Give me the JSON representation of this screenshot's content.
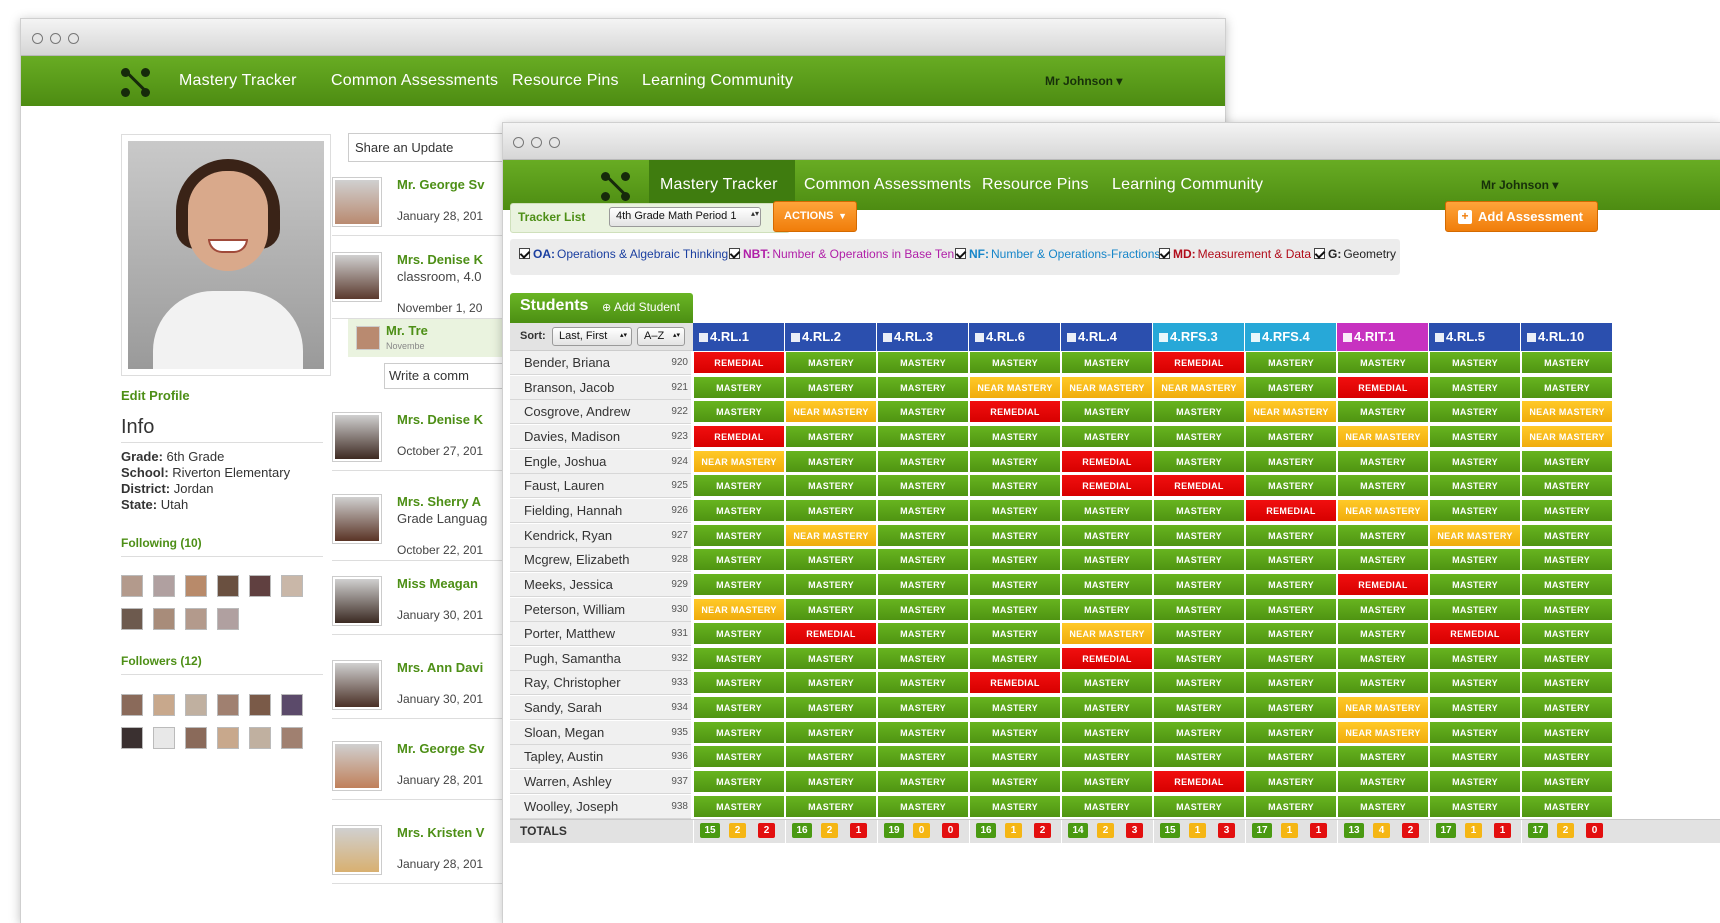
{
  "nav": {
    "items": [
      "Mastery Tracker",
      "Common Assessments",
      "Resource Pins",
      "Learning Community"
    ],
    "user": "Mr Johnson ▾"
  },
  "profile": {
    "edit": "Edit Profile",
    "info_title": "Info",
    "grade_label": "Grade:",
    "grade": "6th Grade",
    "school_label": "School:",
    "school": "Riverton Elementary",
    "district_label": "District:",
    "district": "Jordan",
    "state_label": "State:",
    "state": "Utah",
    "following": "Following (10)",
    "followers": "Followers (12)"
  },
  "feed": {
    "share_placeholder": "Share an Update",
    "write_placeholder": "Write a comm",
    "items": [
      {
        "name": "Mr. George Sv",
        "date": "January 28, 201"
      },
      {
        "name": "Mrs. Denise K",
        "line": "classroom, 4.0",
        "date": "November 1, 20"
      },
      {
        "name": "Mr. Tre",
        "date": "Novembe"
      },
      {
        "name": "Mrs. Denise K",
        "date": "October 27, 201"
      },
      {
        "name": "Mrs. Sherry A",
        "line": "Grade Languag",
        "date": "October 22, 201"
      },
      {
        "name": "Miss Meagan",
        "date": "January 30, 201"
      },
      {
        "name": "Mrs. Ann Davi",
        "date": "January 30, 201"
      },
      {
        "name": "Mr. George Sv",
        "date": "January 28, 201"
      },
      {
        "name": "Mrs. Kristen V",
        "date": "January 28, 201"
      }
    ]
  },
  "tracker": {
    "tracker_list": "Tracker List",
    "class_select": "4th Grade Math Period 1",
    "actions": "ACTIONS",
    "add_assessment": "Add Assessment",
    "categories": [
      {
        "code": "OA:",
        "label": "Operations & Algebraic Thinking",
        "color": "#1b3fa0"
      },
      {
        "code": "NBT:",
        "label": "Number & Operations in Base Ten",
        "color": "#b01fa8"
      },
      {
        "code": "NF:",
        "label": "Number & Operations-Fractions",
        "color": "#1786c9"
      },
      {
        "code": "MD:",
        "label": "Measurement & Data",
        "color": "#b10c1a"
      },
      {
        "code": "G:",
        "label": "Geometry",
        "color": "#222222"
      }
    ],
    "students_title": "Students",
    "add_student": "Add Student",
    "sort_label": "Sort:",
    "sort_field": "Last, First",
    "sort_order": "A–Z",
    "totals_label": "TOTALS",
    "legend": {
      "M": "MASTERY",
      "N": "NEAR MASTERY",
      "R": "REMEDIAL"
    },
    "columns": [
      {
        "name": "4.RL.1",
        "color": "#2b4fae"
      },
      {
        "name": "4.RL.2",
        "color": "#2b4fae"
      },
      {
        "name": "4.RL.3",
        "color": "#2b4fae"
      },
      {
        "name": "4.RL.6",
        "color": "#2b4fae"
      },
      {
        "name": "4.RL.4",
        "color": "#2b4fae"
      },
      {
        "name": "4.RFS.3",
        "color": "#27a8d8"
      },
      {
        "name": "4.RFS.4",
        "color": "#27a8d8"
      },
      {
        "name": "4.RIT.1",
        "color": "#c732c0"
      },
      {
        "name": "4.RL.5",
        "color": "#2b4fae"
      },
      {
        "name": "4.RL.10",
        "color": "#2b4fae"
      }
    ],
    "students": [
      {
        "name": "Bender, Briana",
        "id": "920",
        "marks": [
          "R",
          "M",
          "M",
          "M",
          "M",
          "R",
          "M",
          "M",
          "M",
          "M"
        ]
      },
      {
        "name": "Branson, Jacob",
        "id": "921",
        "marks": [
          "M",
          "M",
          "M",
          "N",
          "N",
          "N",
          "M",
          "R",
          "M",
          "M"
        ]
      },
      {
        "name": "Cosgrove, Andrew",
        "id": "922",
        "marks": [
          "M",
          "N",
          "M",
          "R",
          "M",
          "M",
          "N",
          "M",
          "M",
          "N"
        ]
      },
      {
        "name": "Davies, Madison",
        "id": "923",
        "marks": [
          "R",
          "M",
          "M",
          "M",
          "M",
          "M",
          "M",
          "N",
          "M",
          "N"
        ]
      },
      {
        "name": "Engle, Joshua",
        "id": "924",
        "marks": [
          "N",
          "M",
          "M",
          "M",
          "R",
          "M",
          "M",
          "M",
          "M",
          "M"
        ]
      },
      {
        "name": "Faust, Lauren",
        "id": "925",
        "marks": [
          "M",
          "M",
          "M",
          "M",
          "R",
          "R",
          "M",
          "M",
          "M",
          "M"
        ]
      },
      {
        "name": "Fielding, Hannah",
        "id": "926",
        "marks": [
          "M",
          "M",
          "M",
          "M",
          "M",
          "M",
          "R",
          "N",
          "M",
          "M"
        ]
      },
      {
        "name": "Kendrick, Ryan",
        "id": "927",
        "marks": [
          "M",
          "N",
          "M",
          "M",
          "M",
          "M",
          "M",
          "M",
          "N",
          "M"
        ]
      },
      {
        "name": "Mcgrew, Elizabeth",
        "id": "928",
        "marks": [
          "M",
          "M",
          "M",
          "M",
          "M",
          "M",
          "M",
          "M",
          "M",
          "M"
        ]
      },
      {
        "name": "Meeks, Jessica",
        "id": "929",
        "marks": [
          "M",
          "M",
          "M",
          "M",
          "M",
          "M",
          "M",
          "R",
          "M",
          "M"
        ]
      },
      {
        "name": "Peterson, William",
        "id": "930",
        "marks": [
          "N",
          "M",
          "M",
          "M",
          "M",
          "M",
          "M",
          "M",
          "M",
          "M"
        ]
      },
      {
        "name": "Porter, Matthew",
        "id": "931",
        "marks": [
          "M",
          "R",
          "M",
          "M",
          "N",
          "M",
          "M",
          "M",
          "R",
          "M"
        ]
      },
      {
        "name": "Pugh, Samantha",
        "id": "932",
        "marks": [
          "M",
          "M",
          "M",
          "M",
          "R",
          "M",
          "M",
          "M",
          "M",
          "M"
        ]
      },
      {
        "name": "Ray, Christopher",
        "id": "933",
        "marks": [
          "M",
          "M",
          "M",
          "R",
          "M",
          "M",
          "M",
          "M",
          "M",
          "M"
        ]
      },
      {
        "name": "Sandy, Sarah",
        "id": "934",
        "marks": [
          "M",
          "M",
          "M",
          "M",
          "M",
          "M",
          "M",
          "N",
          "M",
          "M"
        ]
      },
      {
        "name": "Sloan, Megan",
        "id": "935",
        "marks": [
          "M",
          "M",
          "M",
          "M",
          "M",
          "M",
          "M",
          "N",
          "M",
          "M"
        ]
      },
      {
        "name": "Tapley, Austin",
        "id": "936",
        "marks": [
          "M",
          "M",
          "M",
          "M",
          "M",
          "M",
          "M",
          "M",
          "M",
          "M"
        ]
      },
      {
        "name": "Warren, Ashley",
        "id": "937",
        "marks": [
          "M",
          "M",
          "M",
          "M",
          "M",
          "R",
          "M",
          "M",
          "M",
          "M"
        ]
      },
      {
        "name": "Woolley, Joseph",
        "id": "938",
        "marks": [
          "M",
          "M",
          "M",
          "M",
          "M",
          "M",
          "M",
          "M",
          "M",
          "M"
        ]
      }
    ],
    "totals": [
      [
        "15",
        "2",
        "2"
      ],
      [
        "16",
        "2",
        "1"
      ],
      [
        "19",
        "0",
        "0"
      ],
      [
        "16",
        "1",
        "2"
      ],
      [
        "14",
        "2",
        "3"
      ],
      [
        "15",
        "1",
        "3"
      ],
      [
        "17",
        "1",
        "1"
      ],
      [
        "13",
        "4",
        "2"
      ],
      [
        "17",
        "1",
        "1"
      ],
      [
        "17",
        "2",
        "0"
      ]
    ]
  }
}
